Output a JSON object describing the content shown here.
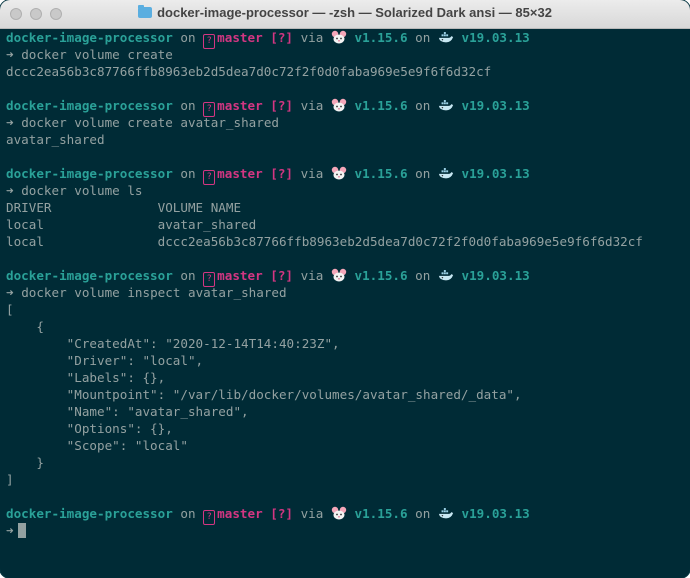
{
  "window": {
    "title": "docker-image-processor — -zsh — Solarized Dark ansi — 85×32",
    "traffic_lights": [
      "close",
      "minimize",
      "zoom"
    ]
  },
  "prompt": {
    "dir": "docker-image-processor",
    "on1": " on ",
    "git_icon": "?",
    "branch": "master",
    "status": " [?]",
    "via": " via ",
    "node": " v1.15.6",
    "on2": " on ",
    "docker": " v19.03.13",
    "arrow": "➜"
  },
  "blocks": [
    {
      "command": "docker volume create",
      "output": [
        "dccc2ea56b3c87766ffb8963eb2d5dea7d0c72f2f0d0faba969e5e9f6f6d32cf"
      ]
    },
    {
      "command": "docker volume create avatar_shared",
      "output": [
        "avatar_shared"
      ]
    },
    {
      "command": "docker volume ls",
      "output": [
        "DRIVER              VOLUME NAME",
        "local               avatar_shared",
        "local               dccc2ea56b3c87766ffb8963eb2d5dea7d0c72f2f0d0faba969e5e9f6f6d32cf"
      ]
    },
    {
      "command": "docker volume inspect avatar_shared",
      "output": [
        "[",
        "    {",
        "        \"CreatedAt\": \"2020-12-14T14:40:23Z\",",
        "        \"Driver\": \"local\",",
        "        \"Labels\": {},",
        "        \"Mountpoint\": \"/var/lib/docker/volumes/avatar_shared/_data\",",
        "        \"Name\": \"avatar_shared\",",
        "        \"Options\": {},",
        "        \"Scope\": \"local\"",
        "    }",
        "]"
      ]
    }
  ],
  "colors": {
    "background": "#002b36",
    "foreground": "#93a1a1",
    "cyan": "#2aa198",
    "magenta": "#d33682"
  }
}
